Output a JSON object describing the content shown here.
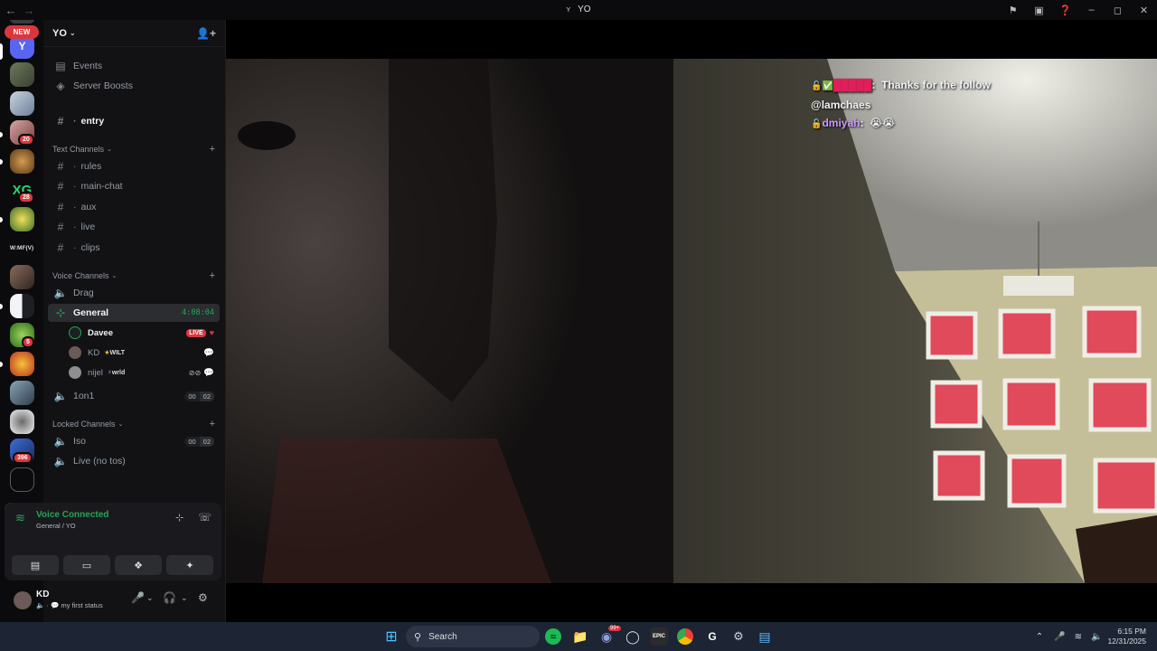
{
  "window": {
    "title": "YO",
    "title_prefix": "Y"
  },
  "guilds": {
    "new_label": "NEW",
    "badges": [
      "20",
      "28",
      "5",
      "396"
    ],
    "text_icons": [
      "XG",
      "W:MF(V)"
    ]
  },
  "server": {
    "name": "YO",
    "menu": [
      {
        "label": "Events",
        "icon": "calendar-icon"
      },
      {
        "label": "Server Boosts",
        "icon": "boost-icon"
      }
    ],
    "entry_channel": "entry",
    "categories": {
      "text": "Text Channels",
      "voice": "Voice Channels",
      "locked": "Locked Channels"
    },
    "text_channels": [
      "rules",
      "main-chat",
      "aux",
      "live",
      "clips"
    ],
    "voice_channels": {
      "drag": "Drag",
      "general": "General",
      "general_timer": "4:08:04",
      "one_on_one": "1on1",
      "one_on_one_counts": [
        "00",
        "02"
      ]
    },
    "general_members": [
      {
        "name": "Davee",
        "badge": "LIVE"
      },
      {
        "name": "KD",
        "tag": "WILT"
      },
      {
        "name": "nijel",
        "tag": "wrld"
      }
    ],
    "locked_channels": [
      {
        "name": "Iso",
        "counts": [
          "00",
          "02"
        ]
      },
      {
        "name": "Live (no tos)"
      }
    ]
  },
  "voice_panel": {
    "status": "Voice Connected",
    "location": "General / YO"
  },
  "user_panel": {
    "name": "KD",
    "status": "my first status"
  },
  "stream_chat": {
    "line1_message": "Thanks for the follow",
    "line2_mention": "@lamchaes",
    "line3_user": "dmiyah",
    "line3_message": "😭😭",
    "user1_color": "#e01e5a",
    "user3_color": "#c79bff"
  },
  "taskbar": {
    "search_placeholder": "Search",
    "time": "6:15 PM",
    "date": "12/31/2025",
    "discord_badge": "99+"
  },
  "colors": {
    "accent_green": "#23a55a",
    "live_red": "#da373c",
    "blurple": "#5865f2"
  }
}
